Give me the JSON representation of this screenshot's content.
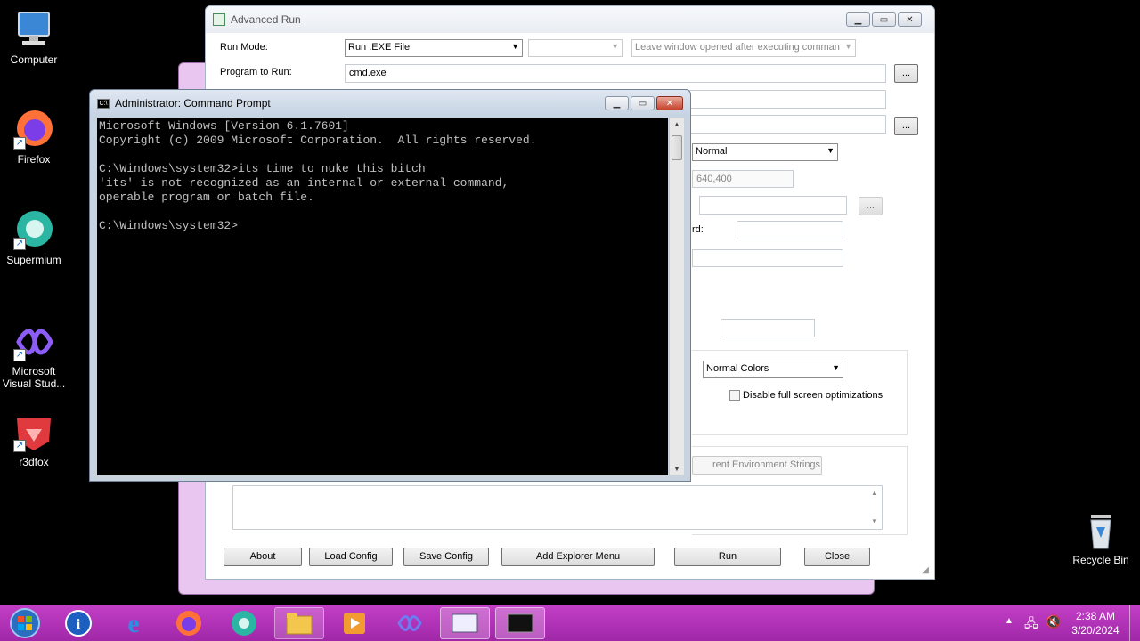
{
  "desktop": {
    "icons": [
      {
        "label": "Computer"
      },
      {
        "label": "Firefox"
      },
      {
        "label": "Supermium"
      },
      {
        "label": "Microsoft Visual Stud..."
      },
      {
        "label": "r3dfox"
      },
      {
        "label": "Recycle Bin"
      }
    ]
  },
  "advanced_run": {
    "title": "Advanced Run",
    "run_mode_label": "Run Mode:",
    "run_mode_value": "Run .EXE File",
    "window_option": "Leave window opened after executing comman",
    "program_label": "Program to Run:",
    "program_value": "cmd.exe",
    "browse": "...",
    "window_state": "Normal",
    "window_size": "640,400",
    "password_label_fragment": "rd:",
    "colors_value": "Normal Colors",
    "disable_fullscreen_label": "Disable full screen optimizations",
    "env_button_fragment": "rent Environment Strings",
    "buttons": {
      "about": "About",
      "load_config": "Load Config",
      "save_config": "Save Config",
      "add_explorer_menu": "Add Explorer Menu",
      "run": "Run",
      "close": "Close"
    }
  },
  "cmd": {
    "title": "Administrator:  Command Prompt",
    "console_text": "Microsoft Windows [Version 6.1.7601]\nCopyright (c) 2009 Microsoft Corporation.  All rights reserved.\n\nC:\\Windows\\system32>its time to nuke this bitch\n'its' is not recognized as an internal or external command,\noperable program or batch file.\n\nC:\\Windows\\system32>"
  },
  "taskbar": {
    "time": "2:38 AM",
    "date": "3/20/2024"
  },
  "colors": {
    "taskbar": "#b233b8",
    "console_bg": "#000000",
    "console_text": "#c0c0c0"
  }
}
